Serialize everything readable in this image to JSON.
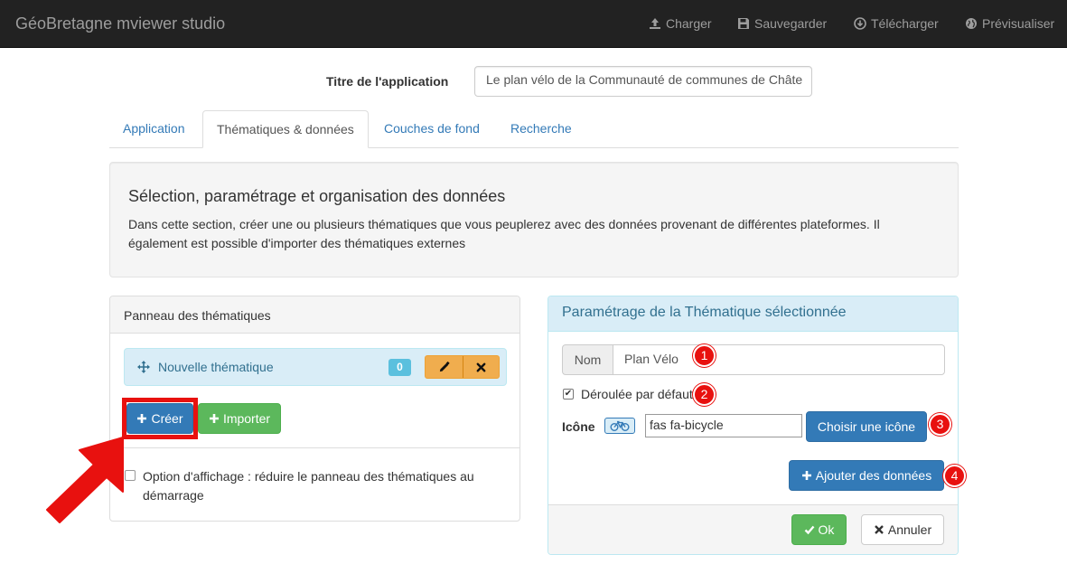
{
  "navbar": {
    "brand": "GéoBretagne mviewer studio",
    "items": [
      {
        "label": "Charger",
        "icon": "upload-icon"
      },
      {
        "label": "Sauvegarder",
        "icon": "floppy-icon"
      },
      {
        "label": "Télécharger",
        "icon": "download-circle-icon"
      },
      {
        "label": "Prévisualiser",
        "icon": "globe-icon"
      }
    ]
  },
  "app_title": {
    "label": "Titre de l'application",
    "value": "Le plan vélo de la Communauté de communes de Châte"
  },
  "tabs": [
    {
      "label": "Application",
      "active": false
    },
    {
      "label": "Thématiques & données",
      "active": true
    },
    {
      "label": "Couches de fond",
      "active": false
    },
    {
      "label": "Recherche",
      "active": false
    }
  ],
  "intro": {
    "heading": "Sélection, paramétrage et organisation des données",
    "text": "Dans cette section, créer une ou plusieurs thématiques que vous peuplerez avec des données provenant de différentes plateformes. Il également est possible d'importer des thématiques externes"
  },
  "themes_panel": {
    "title": "Panneau des thématiques",
    "items": [
      {
        "name": "Nouvelle thématique",
        "count": "0"
      }
    ],
    "create_label": "Créer",
    "import_label": "Importer",
    "option_label": "Option d'affichage : réduire le panneau des thématiques au démarrage",
    "option_checked": false
  },
  "theme_settings": {
    "title": "Paramétrage de la Thématique sélectionnée",
    "name_addon": "Nom",
    "name_value": "Plan Vélo",
    "default_open_label": "Déroulée par défaut",
    "default_open_checked": true,
    "icon_label": "Icône",
    "icon_name": "bicycle-icon",
    "icon_value": "fas fa-bicycle",
    "choose_icon_label": "Choisir une icône",
    "add_data_label": "Ajouter des données",
    "ok_label": "Ok",
    "cancel_label": "Annuler"
  },
  "annotations": [
    "1",
    "2",
    "3",
    "4"
  ],
  "colors": {
    "navbar": "#222222",
    "primary": "#337ab7",
    "success": "#5cb85c",
    "warning": "#f0ad4e",
    "info_bg": "#d9edf7",
    "highlight_red": "#e8110f"
  }
}
